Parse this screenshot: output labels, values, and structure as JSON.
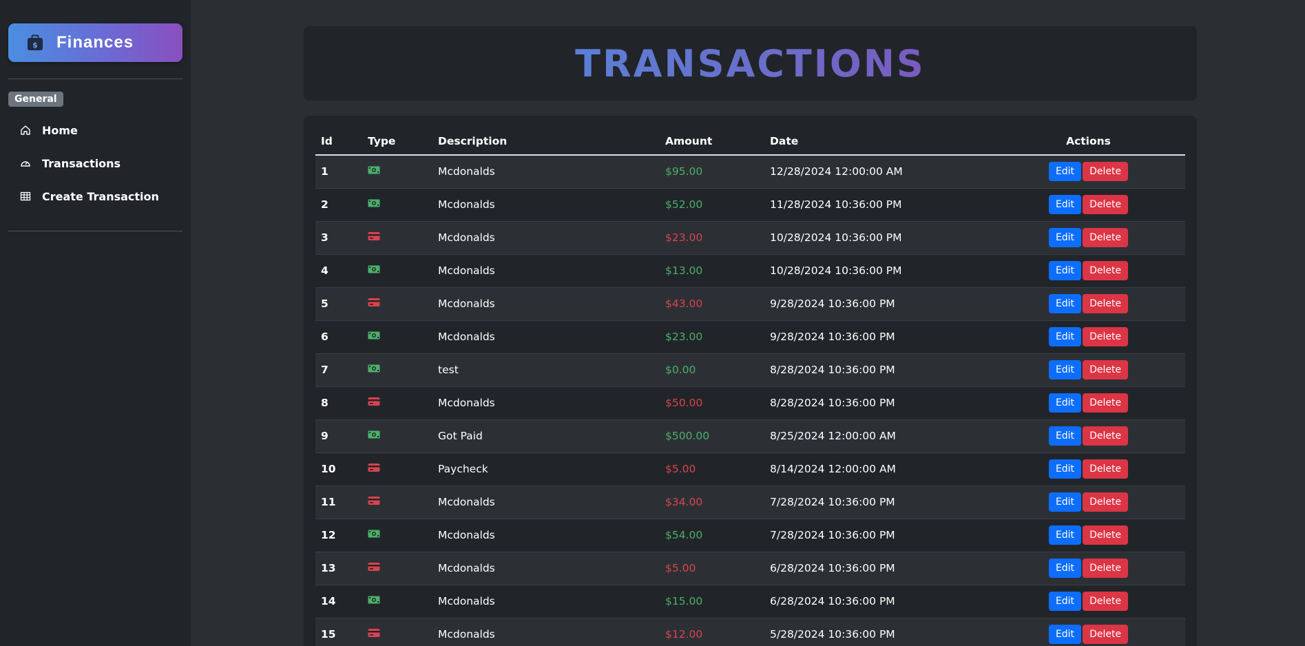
{
  "colors": {
    "income": "#4caf6a",
    "expense": "#d9434f",
    "edit": "#0d6efd",
    "delete": "#dc3545",
    "sidebar_bg": "#212529",
    "page_bg": "#2b2f34"
  },
  "sidebar": {
    "brand": {
      "icon": "briefcase-dollar-icon",
      "title": "Finances"
    },
    "section_label": "General",
    "items": [
      {
        "label": "Home",
        "icon": "house-icon"
      },
      {
        "label": "Transactions",
        "icon": "speedometer-icon"
      },
      {
        "label": "Create Transaction",
        "icon": "table-grid-icon"
      }
    ]
  },
  "page": {
    "title": "TRANSACTIONS"
  },
  "table": {
    "headers": {
      "id": "Id",
      "type": "Type",
      "description": "Description",
      "amount": "Amount",
      "date": "Date",
      "actions": "Actions"
    },
    "edit_label": "Edit",
    "delete_label": "Delete",
    "rows": [
      {
        "id": "1",
        "type": "income",
        "description": "Mcdonalds",
        "amount": "$95.00",
        "date": "12/28/2024 12:00:00 AM"
      },
      {
        "id": "2",
        "type": "income",
        "description": "Mcdonalds",
        "amount": "$52.00",
        "date": "11/28/2024 10:36:00 PM"
      },
      {
        "id": "3",
        "type": "expense",
        "description": "Mcdonalds",
        "amount": "$23.00",
        "date": "10/28/2024 10:36:00 PM"
      },
      {
        "id": "4",
        "type": "income",
        "description": "Mcdonalds",
        "amount": "$13.00",
        "date": "10/28/2024 10:36:00 PM"
      },
      {
        "id": "5",
        "type": "expense",
        "description": "Mcdonalds",
        "amount": "$43.00",
        "date": "9/28/2024 10:36:00 PM"
      },
      {
        "id": "6",
        "type": "income",
        "description": "Mcdonalds",
        "amount": "$23.00",
        "date": "9/28/2024 10:36:00 PM"
      },
      {
        "id": "7",
        "type": "income",
        "description": "test",
        "amount": "$0.00",
        "date": "8/28/2024 10:36:00 PM"
      },
      {
        "id": "8",
        "type": "expense",
        "description": "Mcdonalds",
        "amount": "$50.00",
        "date": "8/28/2024 10:36:00 PM"
      },
      {
        "id": "9",
        "type": "income",
        "description": "Got Paid",
        "amount": "$500.00",
        "date": "8/25/2024 12:00:00 AM"
      },
      {
        "id": "10",
        "type": "expense",
        "description": "Paycheck",
        "amount": "$5.00",
        "date": "8/14/2024 12:00:00 AM"
      },
      {
        "id": "11",
        "type": "expense",
        "description": "Mcdonalds",
        "amount": "$34.00",
        "date": "7/28/2024 10:36:00 PM"
      },
      {
        "id": "12",
        "type": "income",
        "description": "Mcdonalds",
        "amount": "$54.00",
        "date": "7/28/2024 10:36:00 PM"
      },
      {
        "id": "13",
        "type": "expense",
        "description": "Mcdonalds",
        "amount": "$5.00",
        "date": "6/28/2024 10:36:00 PM"
      },
      {
        "id": "14",
        "type": "income",
        "description": "Mcdonalds",
        "amount": "$15.00",
        "date": "6/28/2024 10:36:00 PM"
      },
      {
        "id": "15",
        "type": "expense",
        "description": "Mcdonalds",
        "amount": "$12.00",
        "date": "5/28/2024 10:36:00 PM"
      }
    ]
  }
}
